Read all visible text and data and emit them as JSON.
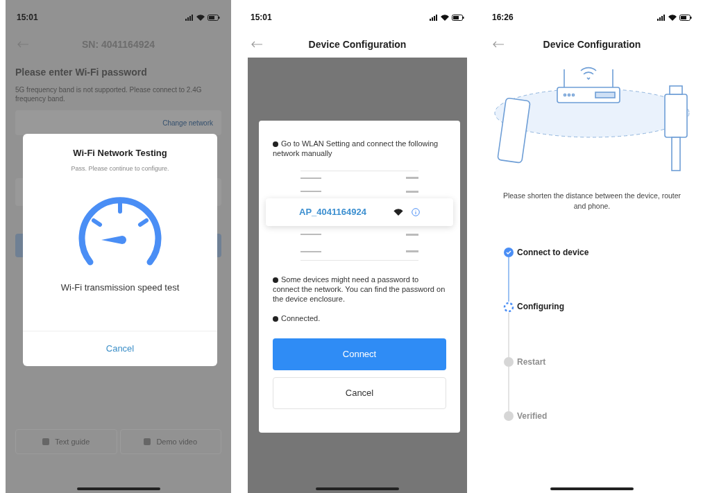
{
  "screens": [
    {
      "kind": "speed_test",
      "status_bar": {
        "time": "15:01"
      },
      "header": {
        "title": "SN: 4041164924"
      },
      "background": {
        "heading": "Please enter Wi-Fi password",
        "note": "5G frequency band is not supported. Please connect to 2.4G frequency band.",
        "network_action": "Change network",
        "buttons": [
          "Text guide",
          "Demo video"
        ]
      },
      "dialog": {
        "title": "Wi-Fi Network Testing",
        "subtitle": "Pass. Please continue to configure.",
        "caption": "Wi-Fi transmission speed test",
        "cancel": "Cancel"
      }
    },
    {
      "kind": "manual_connect",
      "status_bar": {
        "time": "15:01"
      },
      "header": {
        "title": "Device Configuration"
      },
      "dialog": {
        "instructions": [
          "Go to WLAN Setting and connect the following network manually",
          "Some devices might need a password to connect the network. You can find the password on the device enclosure.",
          "Connected."
        ],
        "network": "AP_4041164924",
        "confirm": "Connect",
        "cancel": "Cancel"
      }
    },
    {
      "kind": "progress",
      "status_bar": {
        "time": "16:26"
      },
      "header": {
        "title": "Device Configuration"
      },
      "hint": "Please shorten the distance between the device, router and phone.",
      "steps": [
        {
          "label": "Connect to device",
          "done": true,
          "active": false
        },
        {
          "label": "Configuring",
          "done": false,
          "active": true
        },
        {
          "label": "Restart",
          "done": false,
          "active": false
        },
        {
          "label": "Verified",
          "done": false,
          "active": false
        }
      ]
    }
  ]
}
